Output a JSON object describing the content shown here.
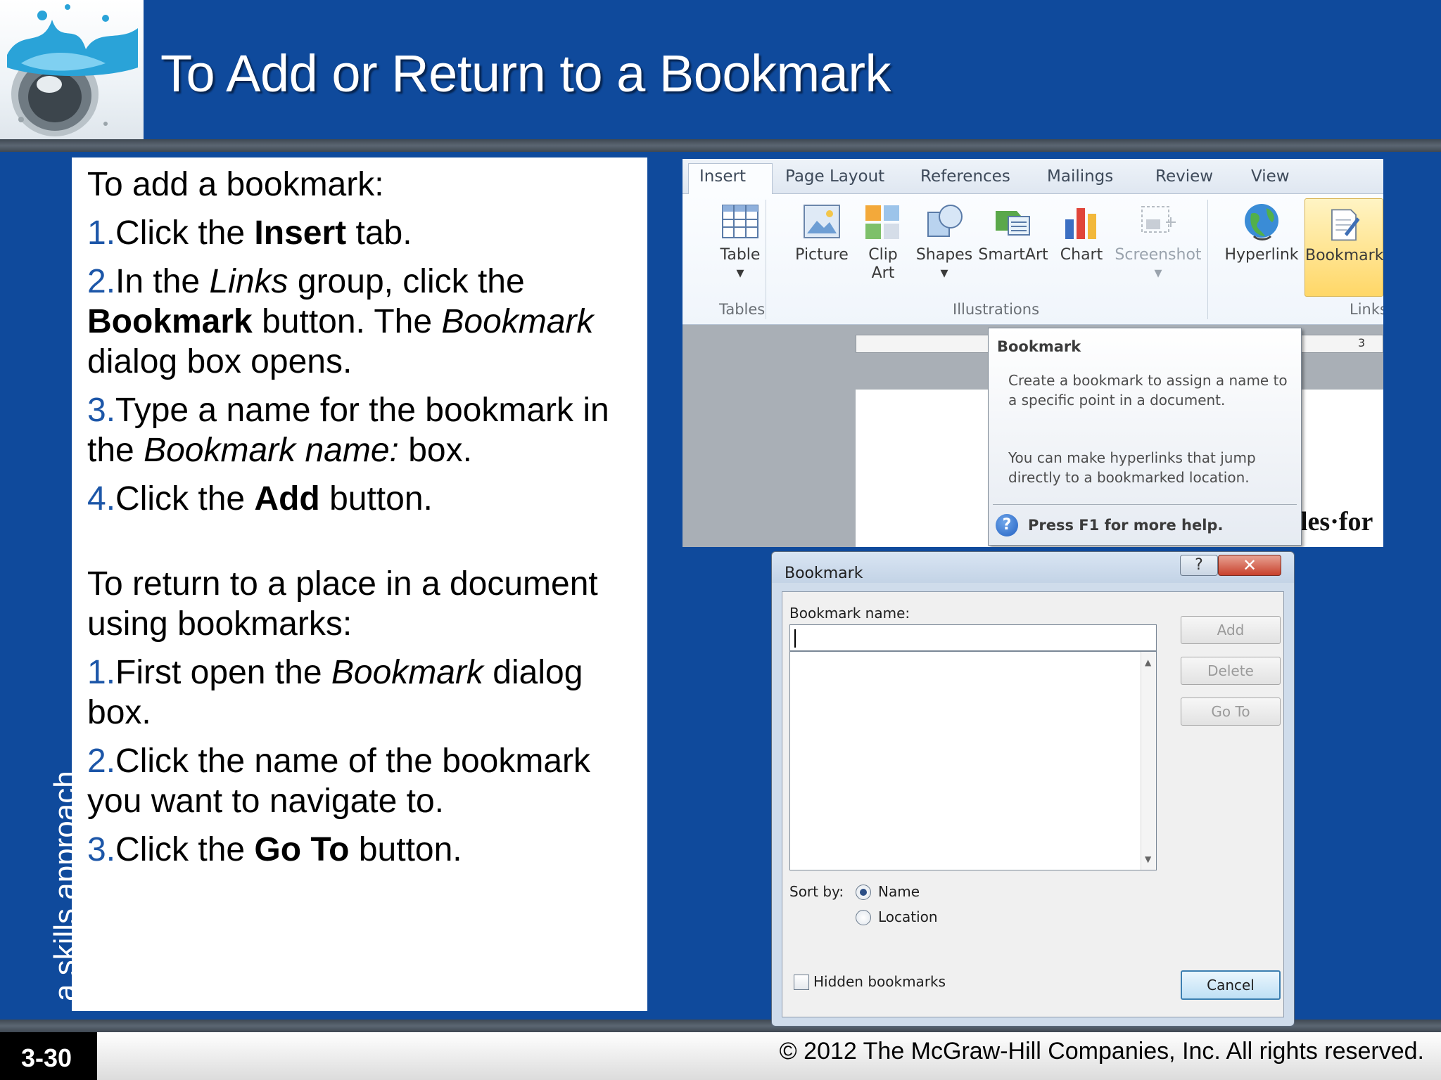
{
  "slide": {
    "title": "To Add or Return to a Bookmark",
    "side_label": "a skills approach",
    "slide_number": "3-30",
    "copyright": "© 2012 The McGraw-Hill Companies, Inc. All rights reserved."
  },
  "instructions": {
    "add_heading": "To add a bookmark:",
    "add_steps": [
      {
        "num": "1.",
        "parts": [
          "Click the ",
          "Insert",
          " tab."
        ]
      },
      {
        "num": "2.",
        "parts": [
          "In the ",
          "Links",
          " group, click the ",
          "Bookmark",
          " button. The ",
          "Bookmark",
          " dialog box opens."
        ]
      },
      {
        "num": "3.",
        "parts": [
          "Type a name for the bookmark in the ",
          "Bookmark name:",
          " box."
        ]
      },
      {
        "num": "4.",
        "parts": [
          "Click the ",
          "Add",
          " button."
        ]
      }
    ],
    "return_heading": "To return to a place in a document using bookmarks:",
    "return_steps": [
      {
        "num": "1.",
        "parts": [
          "First open the ",
          "Bookmark",
          " dialog box."
        ]
      },
      {
        "num": "2.",
        "parts": [
          "Click the name of the bookmark you want to navigate to."
        ]
      },
      {
        "num": "3.",
        "parts": [
          "Click the ",
          "Go To",
          " button."
        ]
      }
    ]
  },
  "ribbon": {
    "tabs": [
      "Insert",
      "Page Layout",
      "References",
      "Mailings",
      "Review",
      "View"
    ],
    "buttons": {
      "table": "Table",
      "picture": "Picture",
      "clip_art_1": "Clip",
      "clip_art_2": "Art",
      "shapes": "Shapes",
      "smartart": "SmartArt",
      "chart": "Chart",
      "screenshot": "Screenshot",
      "hyperlink": "Hyperlink",
      "bookmark": "Bookmark"
    },
    "groups": {
      "tables": "Tables",
      "illustrations": "Illustrations",
      "links": "Links"
    },
    "ruler_mark": "3",
    "doc_text": "les·for"
  },
  "tooltip": {
    "title": "Bookmark",
    "description_1": "Create a bookmark to assign a name to a specific point in a document.",
    "description_2": "You can make hyperlinks that jump directly to a bookmarked location.",
    "help": "Press F1 for more help."
  },
  "dialog": {
    "title": "Bookmark",
    "help_button": "?",
    "close_button": "✕",
    "name_label": "Bookmark name:",
    "name_value": "",
    "buttons": {
      "add": "Add",
      "delete": "Delete",
      "goto": "Go To",
      "cancel": "Cancel"
    },
    "sort_label": "Sort by:",
    "sort_options": [
      "Name",
      "Location"
    ],
    "sort_selected": "Name",
    "hidden_label": "Hidden bookmarks",
    "hidden_checked": false
  }
}
